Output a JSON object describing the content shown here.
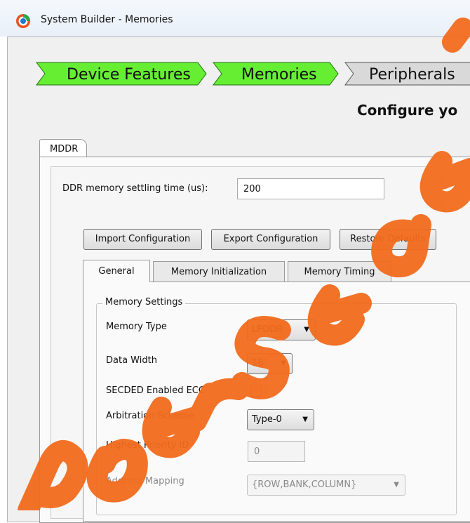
{
  "window": {
    "title": "System Builder - Memories"
  },
  "wizard": {
    "steps": [
      {
        "label": "Device Features",
        "state": "completed",
        "color": "#66ee33"
      },
      {
        "label": "Memories",
        "state": "current",
        "color": "#66ee33"
      },
      {
        "label": "Peripherals",
        "state": "pending",
        "color": "#d9d9d9"
      }
    ]
  },
  "page": {
    "heading": "Configure yo"
  },
  "outer_tabs": [
    {
      "label": "MDDR",
      "selected": true
    }
  ],
  "settling": {
    "label": "DDR memory settling time (us):",
    "value": "200"
  },
  "buttons": {
    "import": "Import Configuration",
    "export": "Export Configuration",
    "restore": "Restore Defaults"
  },
  "inner_tabs": {
    "general": "General",
    "init": "Memory Initialization",
    "timing": "Memory Timing",
    "selected": "General"
  },
  "memory_settings": {
    "title": "Memory Settings",
    "memory_type": {
      "label": "Memory Type",
      "value": "LPDDR"
    },
    "data_width": {
      "label": "Data Width",
      "value": "16"
    },
    "secded": {
      "label": "SECDED Enabled ECC",
      "checked": false
    },
    "arbitration": {
      "label": "Arbitration Scheme",
      "value": "Type-0"
    },
    "priority": {
      "label": "Highest Priority ID",
      "value": "0",
      "enabled": false
    },
    "address_mapping": {
      "label": "Address Mapping",
      "value": "{ROW,BANK,COLUMN}",
      "enabled": false
    }
  },
  "colors": {
    "step_done": "#66ee33",
    "step_pending": "#d9d9d9",
    "watermark": "#f26b1d"
  },
  "arrow_glyph": "▼"
}
